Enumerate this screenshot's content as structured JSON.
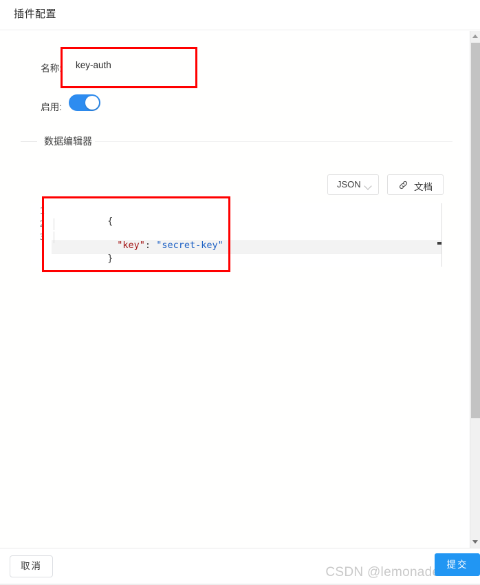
{
  "header": {
    "title": "插件配置"
  },
  "form": {
    "name": {
      "label": "名称:",
      "value": "key-auth"
    },
    "enabled": {
      "label": "启用:",
      "state": "on"
    }
  },
  "editor_section": {
    "legend": "数据编辑器",
    "toolbar": {
      "format_select": {
        "value": "JSON",
        "chevron": "chevron-down-icon"
      },
      "docs_button": {
        "label": "文档",
        "icon": "link-icon"
      }
    },
    "code": {
      "language": "JSON",
      "lines": [
        {
          "number": "1",
          "text": "{"
        },
        {
          "number": "2",
          "key": "\"key\"",
          "colon": ": ",
          "value": "\"secret-key\""
        },
        {
          "number": "3",
          "text": "}"
        }
      ],
      "line_numbers": [
        "1",
        "2",
        "3"
      ],
      "raw": "{\n  \"key\": \"secret-key\"\n}"
    }
  },
  "footer": {
    "cancel_label": "取消",
    "submit_label": "提交",
    "watermark": "CSDN @lemonade-water"
  },
  "scrollbar": {
    "up_arrow": "caret-up-icon",
    "down_arrow": "caret-down-icon"
  },
  "colors": {
    "accent": "#2196f3",
    "toggle_on": "#2d8cf0",
    "annotation": "#ff0000",
    "json_key": "#a31515",
    "json_string": "#1c60c4"
  }
}
